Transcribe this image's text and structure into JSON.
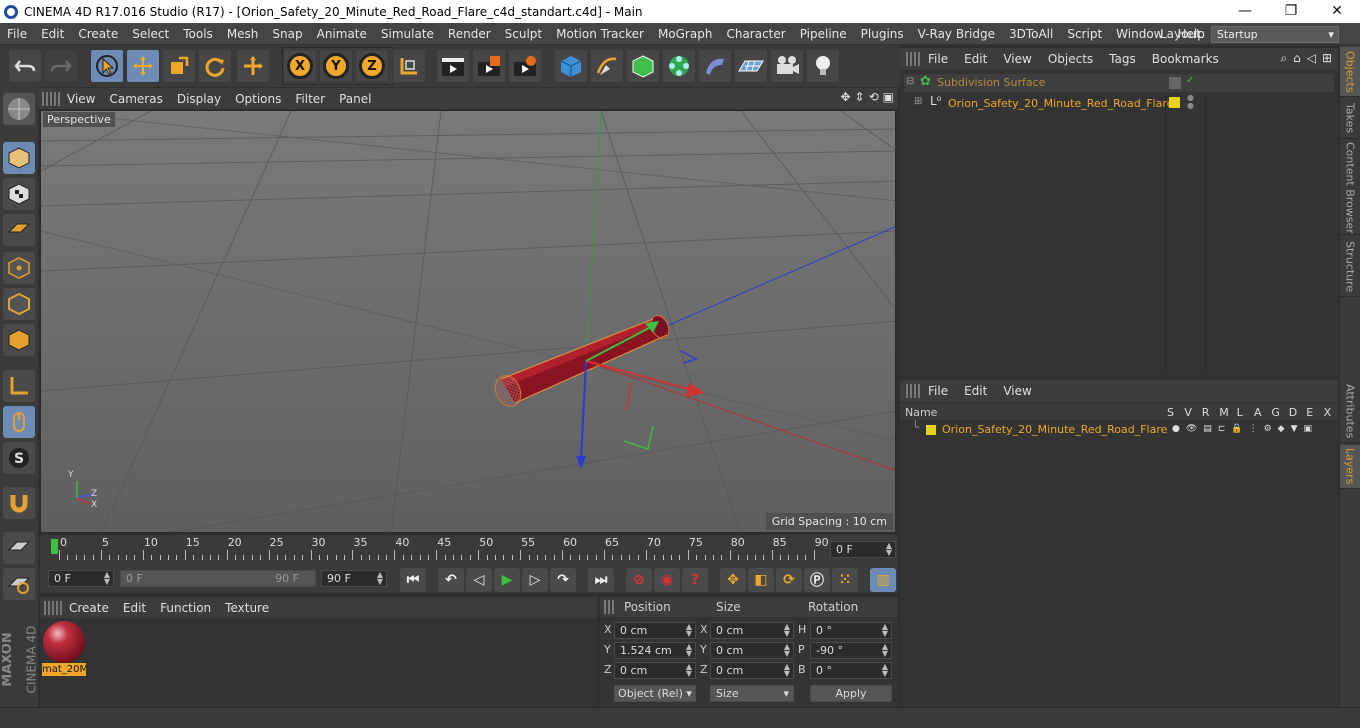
{
  "window": {
    "title": "CINEMA 4D R17.016 Studio (R17) - [Orion_Safety_20_Minute_Red_Road_Flare_c4d_standart.c4d] - Main",
    "controls": [
      "—",
      "❐",
      "✕"
    ]
  },
  "menu": [
    "File",
    "Edit",
    "Create",
    "Select",
    "Tools",
    "Mesh",
    "Snap",
    "Animate",
    "Simulate",
    "Render",
    "Sculpt",
    "Motion Tracker",
    "MoGraph",
    "Character",
    "Pipeline",
    "Plugins",
    "V-Ray Bridge",
    "3DToAll",
    "Script",
    "Window",
    "Help"
  ],
  "layout": {
    "label": "Layout:",
    "value": "Startup"
  },
  "toolbar": {
    "axis_x": "X",
    "axis_y": "Y",
    "axis_z": "Z"
  },
  "viewport": {
    "menu": [
      "View",
      "Cameras",
      "Display",
      "Options",
      "Filter",
      "Panel"
    ],
    "label": "Perspective",
    "grid_spacing": "Grid Spacing : 10 cm",
    "axis_y": "Y",
    "axis_x": "X",
    "axis_z": "Z"
  },
  "timeline": {
    "ticks": [
      "0",
      "5",
      "10",
      "15",
      "20",
      "25",
      "30",
      "35",
      "40",
      "45",
      "50",
      "55",
      "60",
      "65",
      "70",
      "75",
      "80",
      "85",
      "90"
    ],
    "current_frame": "0 F"
  },
  "playback": {
    "start": "0 F",
    "range_start": "0 F",
    "range_end": "90 F",
    "end": "90 F"
  },
  "materials": {
    "menu": [
      "Create",
      "Edit",
      "Function",
      "Texture"
    ],
    "items": [
      {
        "name": "mat_20M"
      }
    ]
  },
  "coords": {
    "headers": {
      "position": "Position",
      "size": "Size",
      "rotation": "Rotation"
    },
    "rows": [
      {
        "axis": "X",
        "pos": "0 cm",
        "size_axis": "X",
        "size": "0 cm",
        "rot_axis": "H",
        "rot": "0 °"
      },
      {
        "axis": "Y",
        "pos": "1.524 cm",
        "size_axis": "Y",
        "size": "0 cm",
        "rot_axis": "P",
        "rot": "-90 °"
      },
      {
        "axis": "Z",
        "pos": "0 cm",
        "size_axis": "Z",
        "size": "0 cm",
        "rot_axis": "B",
        "rot": "0 °"
      }
    ],
    "mode": "Object (Rel)",
    "size_mode": "Size",
    "apply": "Apply"
  },
  "object_manager": {
    "menu": [
      "File",
      "Edit",
      "View",
      "Objects",
      "Tags",
      "Bookmarks"
    ],
    "objects": [
      {
        "name": "Subdivision Surface"
      },
      {
        "name": "Orion_Safety_20_Minute_Red_Road_Flare"
      }
    ]
  },
  "layer_manager": {
    "menu": [
      "File",
      "Edit",
      "View"
    ],
    "columns": {
      "name": "Name",
      "flags": [
        "S",
        "V",
        "R",
        "M",
        "L",
        "A",
        "G",
        "D",
        "E",
        "X"
      ]
    },
    "layers": [
      {
        "name": "Orion_Safety_20_Minute_Red_Road_Flare",
        "color": "#e8d21a"
      }
    ]
  },
  "side_tabs": [
    "Objects",
    "Takes",
    "Content Browser",
    "Structure",
    "Attributes",
    "Layers"
  ],
  "brand": {
    "line1": "MAXON",
    "line2": "CINEMA 4D"
  },
  "colors": {
    "accent_orange": "#f0a72a",
    "selected_blue": "#6c8cb5",
    "flare_red": "#8b1220"
  }
}
